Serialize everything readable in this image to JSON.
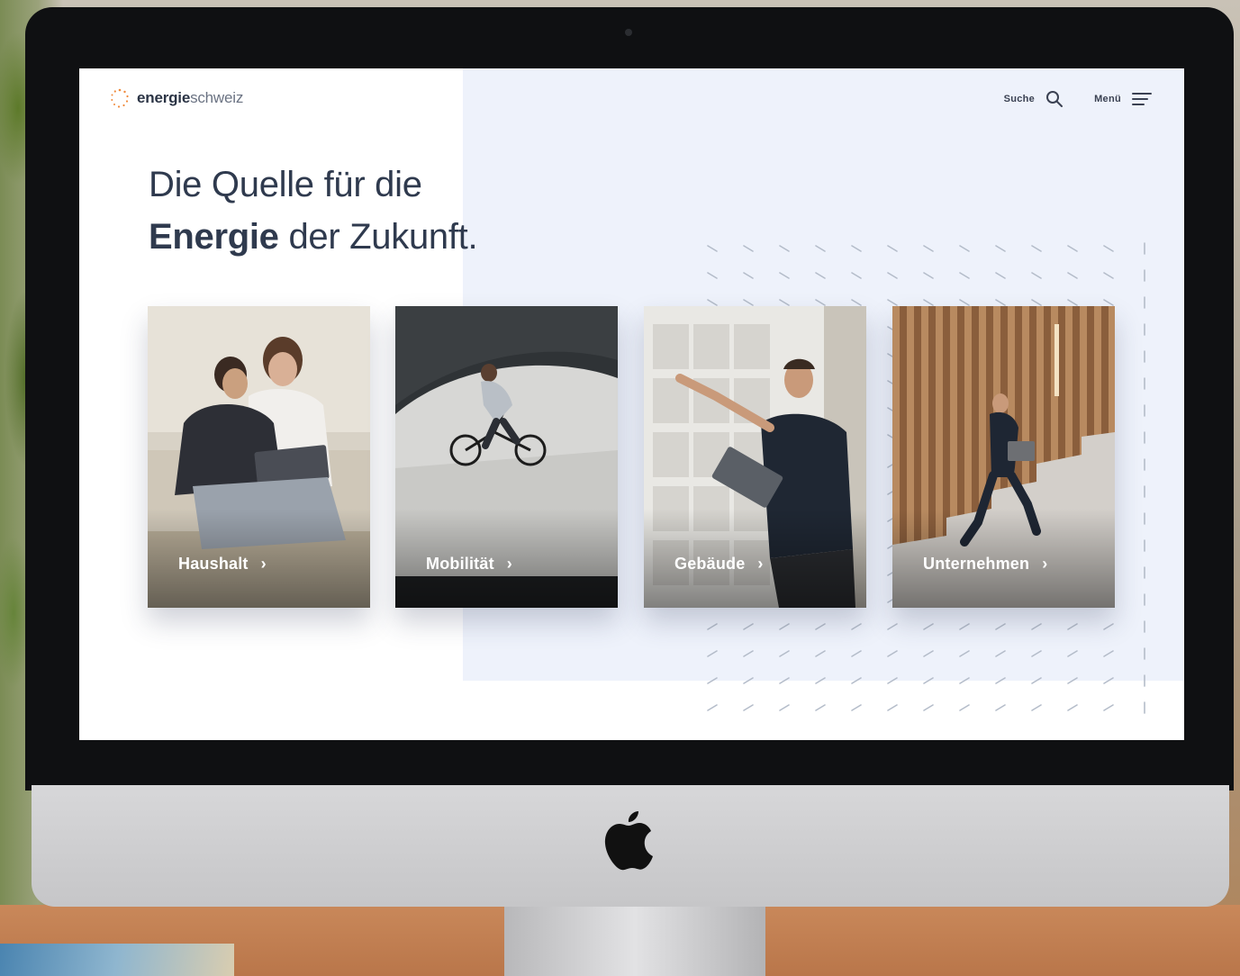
{
  "site": {
    "logo_bold": "energie",
    "logo_light": "schweiz"
  },
  "nav": {
    "search_label": "Suche",
    "menu_label": "Menü"
  },
  "hero": {
    "line1": "Die Quelle für die",
    "line2_bold": "Energie",
    "line2_rest": " der Zukunft."
  },
  "cards": [
    {
      "label": "Haushalt",
      "chevron": "›"
    },
    {
      "label": "Mobilität",
      "chevron": "›"
    },
    {
      "label": "Gebäude",
      "chevron": "›"
    },
    {
      "label": "Unternehmen",
      "chevron": "›"
    }
  ],
  "colors": {
    "text_dark": "#2f3a4e",
    "panel_bg": "#eef2fb",
    "logo_accent": "#f08a3c"
  }
}
